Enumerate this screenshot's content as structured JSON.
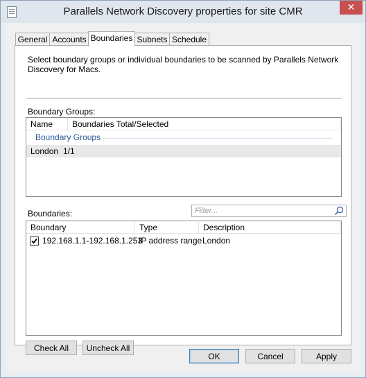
{
  "window": {
    "title": "Parallels Network Discovery properties for site CMR",
    "close_glyph": "✕"
  },
  "tabs": [
    {
      "label": "General"
    },
    {
      "label": "Accounts"
    },
    {
      "label": "Boundaries"
    },
    {
      "label": "Subnets"
    },
    {
      "label": "Schedule"
    }
  ],
  "active_tab": "Boundaries",
  "description": "Select boundary groups or individual boundaries to be scanned by Parallels Network Discovery for Macs.",
  "boundary_groups": {
    "label": "Boundary Groups:",
    "columns": [
      "Name",
      "Boundaries Total/Selected"
    ],
    "group_header": "Boundary Groups",
    "rows": [
      {
        "name": "London",
        "count": "1/1"
      }
    ]
  },
  "boundaries": {
    "label": "Boundaries:",
    "filter_placeholder": "Filter...",
    "columns": [
      "Boundary",
      "Type",
      "Description"
    ],
    "rows": [
      {
        "checked": true,
        "boundary": "192.168.1.1-192.168.1.253",
        "type": "IP address range",
        "description": "London"
      }
    ]
  },
  "buttons": {
    "check_all": "Check All",
    "uncheck_all": "Uncheck All",
    "ok": "OK",
    "cancel": "Cancel",
    "apply": "Apply"
  },
  "colors": {
    "accent": "#3c7fb1",
    "group_header": "#2a5a9a",
    "close": "#c75050"
  }
}
